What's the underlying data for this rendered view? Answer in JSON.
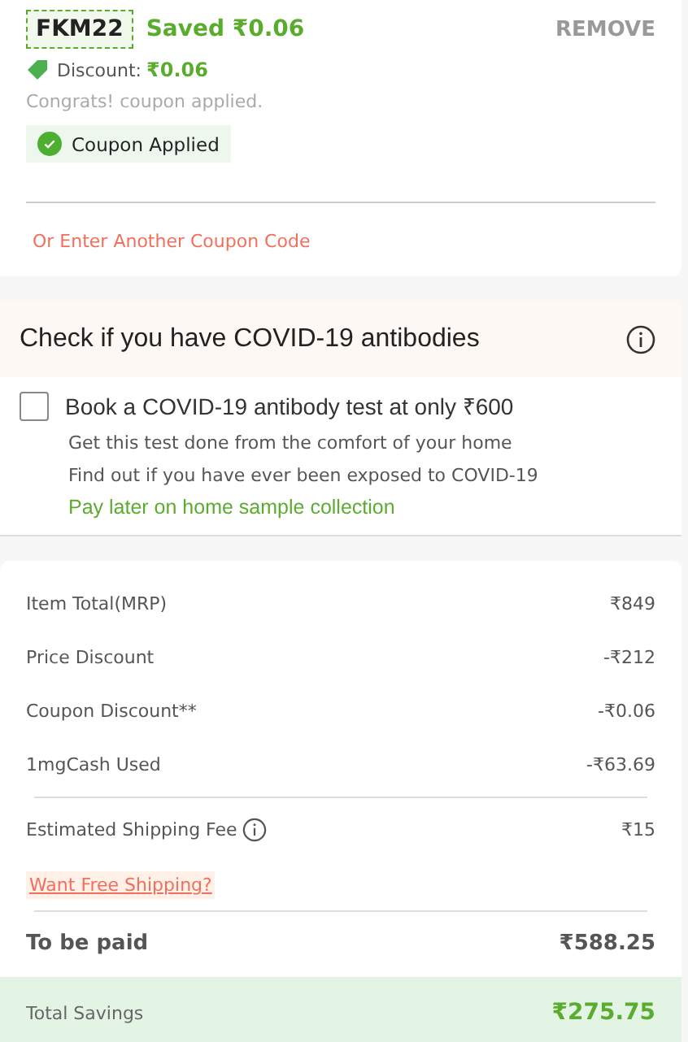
{
  "coupon": {
    "code": "FKM22",
    "saved": "Saved ₹0.06",
    "remove": "REMOVE",
    "discount_label": "Discount:",
    "discount_value": "₹0.06",
    "message": "Congrats! coupon applied.",
    "status": "Coupon Applied",
    "another_link": "Or Enter Another Coupon Code"
  },
  "covid": {
    "title": "Check if you have COVID-19 antibodies",
    "option": {
      "label": "Book a COVID-19 antibody test at only ₹600",
      "checked": false
    },
    "lines": [
      "Get this test done from the comfort of your home",
      "Find out if you have ever been exposed to COVID-19"
    ],
    "note": "Pay later on home sample collection"
  },
  "bill": {
    "rows": [
      {
        "label": "Item Total(MRP)",
        "value": "₹849"
      },
      {
        "label": "Price Discount",
        "value": "-₹212"
      },
      {
        "label": "Coupon Discount**",
        "value": "-₹0.06"
      },
      {
        "label": "1mgCash Used",
        "value": "-₹63.69"
      }
    ],
    "shipping": {
      "label": "Estimated Shipping Fee",
      "value": "₹15"
    },
    "free_shipping_link": "Want Free Shipping?",
    "to_be_paid": {
      "label": "To be paid",
      "value": "₹588.25"
    },
    "savings": {
      "label": "Total Savings",
      "value": "₹275.75"
    }
  }
}
